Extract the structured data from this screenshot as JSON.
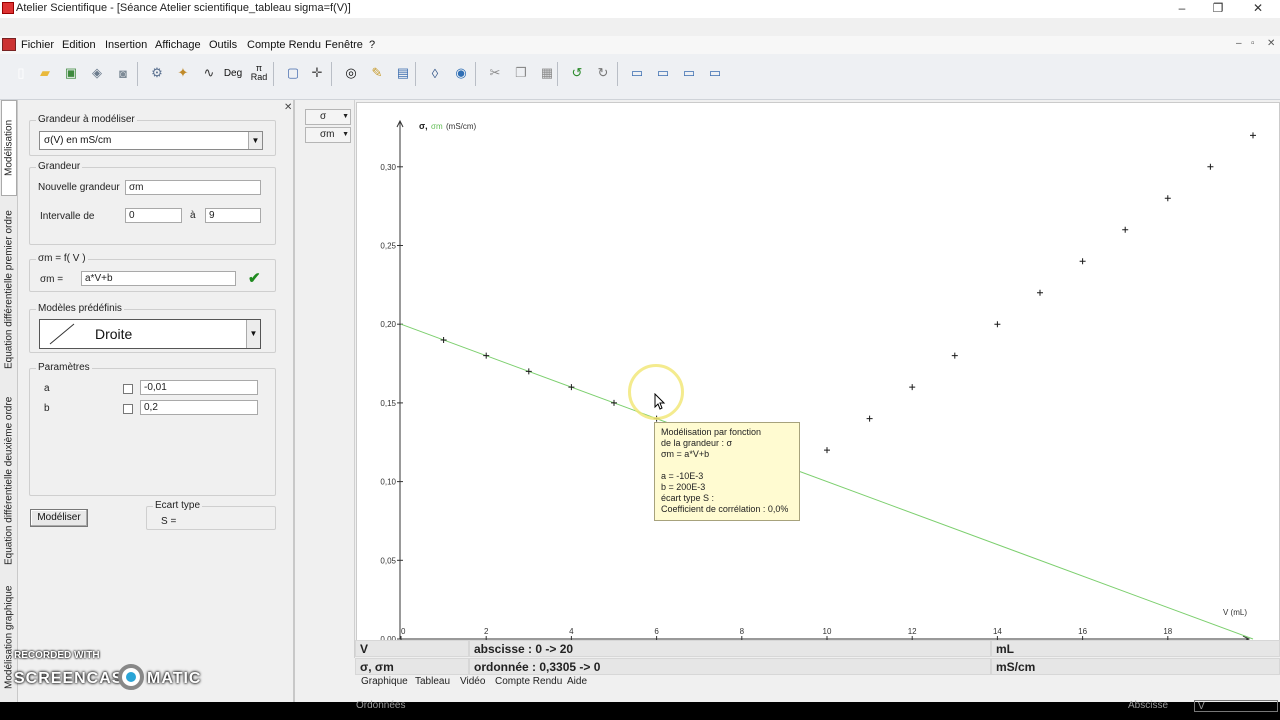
{
  "window": {
    "title": "Atelier Scientifique - [Séance Atelier scientifique_tableau sigma=f(V)]",
    "minimize": "–",
    "restore": "❐",
    "close": "✕"
  },
  "menu": {
    "items": [
      "Fichier",
      "Edition",
      "Insertion",
      "Affichage",
      "Outils",
      "Compte Rendu",
      "Fenêtre",
      "?"
    ],
    "mdi_minimize": "–",
    "mdi_restore": "▫",
    "mdi_close": "✕"
  },
  "toolbar": {
    "buttons": [
      {
        "icon": "new-file-icon",
        "glyph": "▯",
        "color": "#ffffff"
      },
      {
        "icon": "open-folder-icon",
        "glyph": "▰",
        "color": "#e9b93c"
      },
      {
        "icon": "save-icon",
        "glyph": "▣",
        "color": "#3e8a3e"
      },
      {
        "icon": "properties-icon",
        "glyph": "◈",
        "color": "#6b7b8c"
      },
      {
        "icon": "print-icon",
        "glyph": "◙",
        "color": "#7d8a96"
      },
      {
        "icon": "tools-icon",
        "glyph": "⚙",
        "color": "#5b7190"
      },
      {
        "icon": "pointer-icon",
        "glyph": "✦",
        "color": "#c08a2a"
      },
      {
        "icon": "curve-icon",
        "glyph": "∿",
        "color": "#3a3a3a"
      },
      {
        "icon": "deg-icon",
        "glyph": "Deg",
        "color": "#111111"
      },
      {
        "icon": "rad-icon",
        "glyph": "π\nRad",
        "color": "#111111"
      },
      {
        "icon": "frame-icon",
        "glyph": "▢",
        "color": "#4a6fb0"
      },
      {
        "icon": "crosshair-icon",
        "glyph": "✛",
        "color": "#555555"
      },
      {
        "icon": "target-icon",
        "glyph": "◎",
        "color": "#111111"
      },
      {
        "icon": "pencil-icon",
        "glyph": "✎",
        "color": "#c79b2c"
      },
      {
        "icon": "book-icon",
        "glyph": "▤",
        "color": "#3f6fb0"
      },
      {
        "icon": "wave-icon",
        "glyph": "◊",
        "color": "#3f5f8f"
      },
      {
        "icon": "globe-icon",
        "glyph": "◉",
        "color": "#2f6fb5"
      },
      {
        "icon": "cut-icon",
        "glyph": "✂",
        "color": "#8a8a8a"
      },
      {
        "icon": "copy-icon",
        "glyph": "❐",
        "color": "#8a8a8a"
      },
      {
        "icon": "paste-icon",
        "glyph": "▦",
        "color": "#8a8a8a"
      },
      {
        "icon": "undo-icon",
        "glyph": "↺",
        "color": "#2a8a2a"
      },
      {
        "icon": "redo-icon",
        "glyph": "↻",
        "color": "#777777"
      },
      {
        "icon": "window-1-icon",
        "glyph": "▭",
        "color": "#3a6db0"
      },
      {
        "icon": "window-2-icon",
        "glyph": "▭",
        "color": "#3a6db0"
      },
      {
        "icon": "window-3-icon",
        "glyph": "▭",
        "color": "#3a6db0"
      },
      {
        "icon": "window-4-icon",
        "glyph": "▭",
        "color": "#3a6db0"
      }
    ]
  },
  "side_tabs": [
    "Modélisation",
    "Equation différentielle premier ordre",
    "Equation différentielle deuxième ordre",
    "Modélisation graphique"
  ],
  "panel": {
    "close": "✕",
    "grandeur_a_modeliser": {
      "label": "Grandeur à modéliser",
      "value": "σ(V) en mS/cm"
    },
    "grandeur": {
      "label": "Grandeur",
      "nouvelle_label": "Nouvelle grandeur",
      "nouvelle_value": "σm",
      "intervalle_label": "Intervalle de",
      "from": "0",
      "a_label": "à",
      "to": "9"
    },
    "equation": {
      "label": "σm = f( V )",
      "lhs": "σm =",
      "value": "a*V+b",
      "check": "✔"
    },
    "modeles": {
      "label": "Modèles prédéfinis",
      "value": "Droite"
    },
    "parametres": {
      "label": "Paramètres",
      "rows": [
        {
          "name": "a",
          "value": "-0,01"
        },
        {
          "name": "b",
          "value": "0,2"
        }
      ]
    },
    "modeliser_button": "Modéliser",
    "ecart": {
      "label": "Ecart type",
      "value": "S ="
    }
  },
  "selector": {
    "items": [
      "σ",
      "σm"
    ]
  },
  "graph": {
    "legend_sigma": "σ,",
    "legend_sigma_m": "σm",
    "legend_unit": "(mS/cm)",
    "x_axis_label": "V (mL)",
    "y_ticks": [
      "0,00",
      "0,05",
      "0,10",
      "0,15",
      "0,20",
      "0,25",
      "0,30"
    ],
    "x_ticks": [
      "0",
      "2",
      "4",
      "6",
      "8",
      "10",
      "12",
      "14",
      "16",
      "18"
    ],
    "tooltip": [
      "Modélisation par fonction",
      "de la grandeur : σ",
      "σm = a*V+b",
      "",
      "a = -10E-3",
      "b = 200E-3",
      "écart type S :",
      "Coefficient de corrélation : 0,0%"
    ]
  },
  "chart_data": {
    "type": "scatter",
    "xlim": [
      0,
      20
    ],
    "ylim": [
      0,
      0.33
    ],
    "series": [
      {
        "name": "σ",
        "color": "#1a1a1a",
        "x": [
          1,
          2,
          3,
          4,
          5,
          6,
          7,
          8,
          9,
          10,
          11,
          12,
          13,
          14,
          15,
          16,
          17,
          18,
          19,
          20
        ],
        "y": [
          0.19,
          0.18,
          0.17,
          0.16,
          0.15,
          0.14,
          0.13,
          0.12,
          0.11,
          0.12,
          0.14,
          0.16,
          0.18,
          0.2,
          0.22,
          0.24,
          0.26,
          0.28,
          0.3,
          0.32
        ]
      },
      {
        "name": "σm",
        "color": "#7ccf6e",
        "type": "line",
        "x": [
          0,
          20
        ],
        "y": [
          0.2,
          0.0
        ]
      }
    ]
  },
  "info": {
    "row1_var": "V",
    "row1_range": "abscisse : 0 -> 20",
    "row1_unit": "mL",
    "row2_var": "σ, σm",
    "row2_range": "ordonnée : 0,3305 -> 0",
    "row2_unit": "mS/cm"
  },
  "bottom_tabs": [
    "Graphique",
    "Tableau",
    "Vidéo",
    "Compte Rendu",
    "Aide"
  ],
  "footer": {
    "left": "Ordonnées",
    "right_label": "Abscisse",
    "right_value": "V"
  },
  "watermark": {
    "line1": "RECORDED WITH",
    "brand_left": "SCREENCAST",
    "brand_right": "MATIC"
  }
}
